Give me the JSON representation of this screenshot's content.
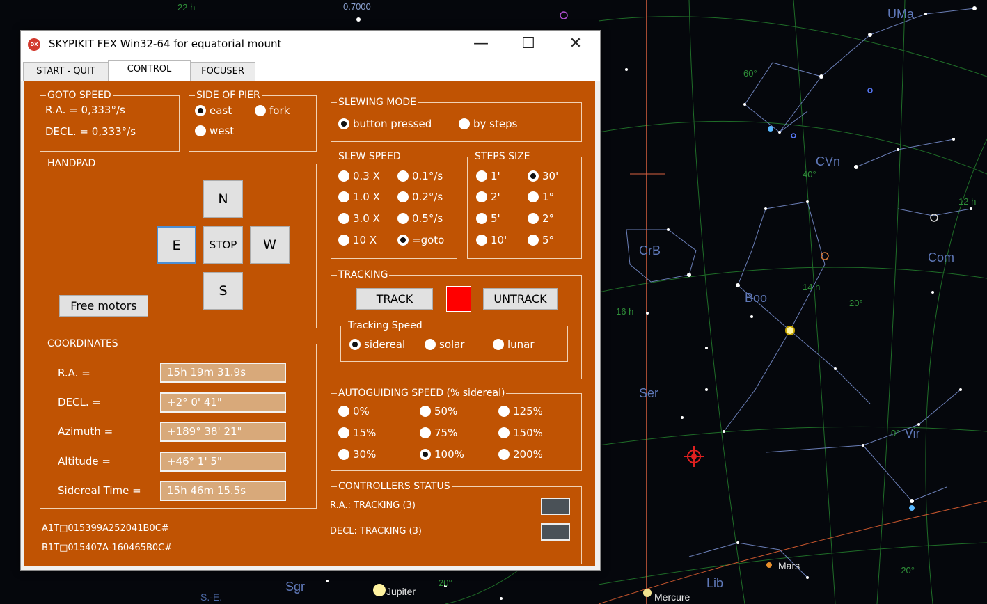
{
  "window": {
    "app_icon_text": "DX",
    "title": "SKYPIKIT FEX Win32-64  for equatorial mount",
    "minimize_glyph": "—",
    "maximize_glyph": "☐",
    "close_glyph": "✕",
    "tabs": [
      {
        "label": "START - QUIT"
      },
      {
        "label": "CONTROL"
      },
      {
        "label": "FOCUSER"
      }
    ],
    "active_tab": "CONTROL"
  },
  "goto_speed": {
    "title": "GOTO SPEED",
    "ra": "R.A. = 0,333°/s",
    "decl": "DECL. = 0,333°/s"
  },
  "side_of_pier": {
    "title": "SIDE OF PIER",
    "options": [
      "east",
      "fork",
      "west"
    ],
    "selected": "east"
  },
  "slewing_mode": {
    "title": "SLEWING MODE",
    "options": [
      "button pressed",
      "by steps"
    ],
    "selected": "button pressed"
  },
  "slew_speed": {
    "title": "SLEW SPEED",
    "options": [
      "0.3 X",
      "0.1°/s",
      "1.0 X",
      "0.2°/s",
      "3.0 X",
      "0.5°/s",
      "10 X",
      "=goto"
    ],
    "selected": "=goto"
  },
  "steps_size": {
    "title": "STEPS SIZE",
    "options": [
      "1'",
      "30'",
      "2'",
      "1°",
      "5'",
      "2°",
      "10'",
      "5°"
    ],
    "selected": "30'"
  },
  "handpad": {
    "title": "HANDPAD",
    "n": "N",
    "s": "S",
    "e": "E",
    "w": "W",
    "stop": "STOP",
    "free_motors": "Free motors"
  },
  "tracking": {
    "title": "TRACKING",
    "track": "TRACK",
    "untrack": "UNTRACK",
    "indicator_color": "#ff0000",
    "speed_title": "Tracking Speed",
    "speed_options": [
      "sidereal",
      "solar",
      "lunar"
    ],
    "speed_selected": "sidereal"
  },
  "coordinates": {
    "title": "COORDINATES",
    "rows": [
      {
        "label": "R.A. =",
        "value": "15h 19m 31.9s"
      },
      {
        "label": "DECL. =",
        "value": "+2° 0' 41\""
      },
      {
        "label": "Azimuth =",
        "value": "+189° 38' 21\""
      },
      {
        "label": "Altitude =",
        "value": "+46° 1' 5\""
      },
      {
        "label": "Sidereal Time =",
        "value": "15h 46m 15.5s"
      }
    ]
  },
  "autoguiding": {
    "title": "AUTOGUIDING SPEED  (% sidereal)",
    "options": [
      "0%",
      "50%",
      "125%",
      "15%",
      "75%",
      "150%",
      "30%",
      "100%",
      "200%"
    ],
    "selected": "100%"
  },
  "controllers_status": {
    "title": "CONTROLLERS STATUS",
    "ra": "R.A.: TRACKING (3)",
    "decl": "DECL: TRACKING (3)"
  },
  "raw": {
    "line1": "A1T□015399A252041B0C#",
    "line2": "B1T□015407A-160465B0C#"
  },
  "sky": {
    "constellations": [
      "UMa",
      "CVn",
      "CrB",
      "Com",
      "Boo",
      "Ser",
      "Vir",
      "Lib",
      "Sgr"
    ],
    "grid_labels": [
      "22 h",
      "60°",
      "40°",
      "12 h",
      "14 h",
      "16 h",
      "20°",
      "0°",
      "-20°",
      "20°"
    ],
    "planets": [
      "Mars",
      "Mercure",
      "Jupiter"
    ],
    "direction": "S.-E.",
    "top_label": "0.7000"
  }
}
